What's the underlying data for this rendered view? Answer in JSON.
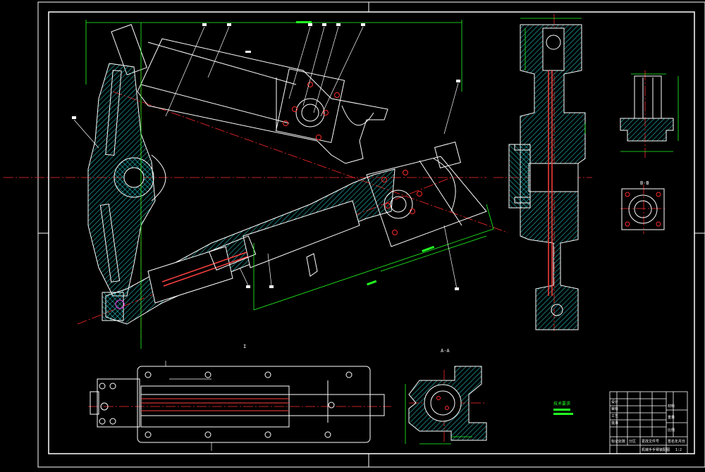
{
  "drawing": {
    "background": "#000000",
    "colors": {
      "outline": "#ffffff",
      "hatch": "#1fbfbf",
      "centerline": "#ff2a2a",
      "dimension": "#22ff22",
      "hidden_parts": "#ff4040"
    },
    "annotations": {
      "section_label_1": "A-A",
      "section_label_2": "B-B",
      "view_label": "I",
      "note_text": "技术要求"
    },
    "title_block": {
      "drawing_name": "机械手手臂装配图",
      "sheet": "1:2",
      "cells": [
        "标记",
        "处数",
        "分区",
        "更改文件号",
        "签名",
        "年月日",
        "设计",
        "审核",
        "工艺",
        "批准",
        "材料",
        "重量",
        "比例"
      ]
    }
  }
}
